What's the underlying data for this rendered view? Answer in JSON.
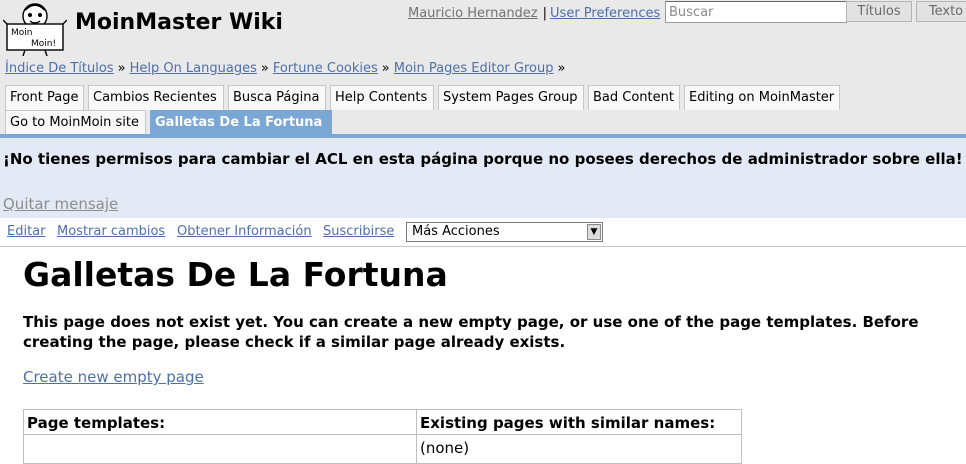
{
  "header": {
    "logo_text_top": "Moin",
    "logo_text_bottom": "Moin!",
    "site_name": "MoinMaster Wiki",
    "user": {
      "name": "Mauricio Hernandez",
      "separator": "|",
      "preferences": "User Preferences"
    },
    "search": {
      "placeholder": "Buscar",
      "titles_button": "Títulos",
      "text_button": "Texto"
    }
  },
  "pagetrail": {
    "items": [
      "Índice De Títulos",
      "Help On Languages",
      "Fortune Cookies",
      "Moin Pages Editor Group"
    ],
    "separator": "»"
  },
  "navibar": {
    "items": [
      "Front Page",
      "Cambios Recientes",
      "Busca Página",
      "Help Contents",
      "System Pages Group",
      "Bad Content",
      "Editing on MoinMaster",
      "Go to MoinMoin site"
    ],
    "current": "Galletas De La Fortuna"
  },
  "message": {
    "text": "¡No tienes permisos para cambiar el ACL en esta página porque no posees derechos de administrador sobre ella!",
    "close": "Quitar mensaje"
  },
  "editbar": {
    "edit": "Editar",
    "diff": "Mostrar cambios",
    "info": "Obtener Información",
    "subscribe": "Suscribirse",
    "more_actions": "Más Acciones"
  },
  "content": {
    "title": "Galletas De La Fortuna",
    "nonexistent_text": "This page does not exist yet. You can create a new empty page, or use one of the page templates. Before creating the page, please check if a similar page already exists.",
    "create_link": "Create new empty page",
    "table": {
      "col1_header": "Page templates:",
      "col2_header": "Existing pages with similar names:",
      "col2_value": "(none)"
    }
  }
}
